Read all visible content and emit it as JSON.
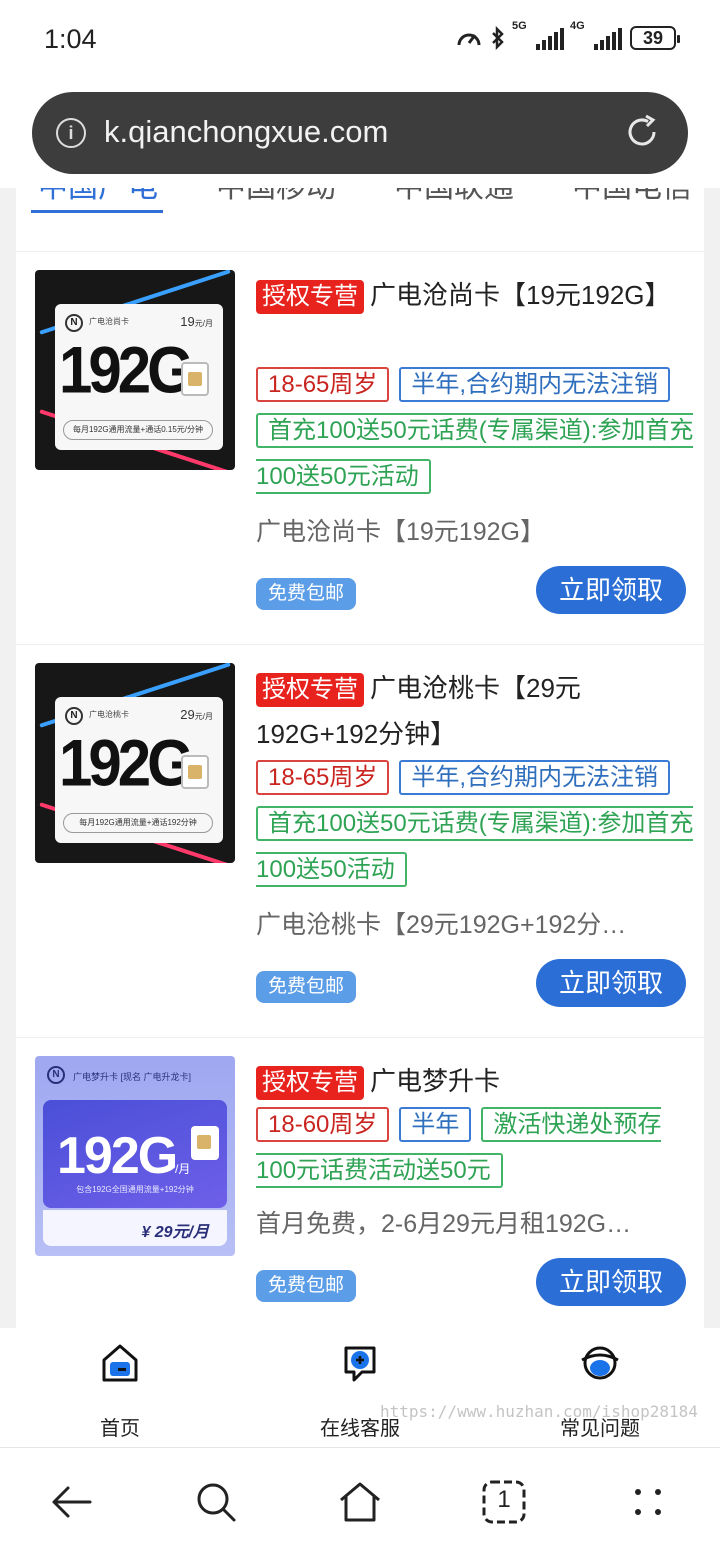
{
  "status": {
    "time": "1:04",
    "battery": "39",
    "net1": "5G",
    "net2": "4G"
  },
  "browser": {
    "url": "k.qianchongxue.com"
  },
  "tabs": [
    "中国广电",
    "中国移动",
    "中国联通",
    "中国电信"
  ],
  "products": [
    {
      "badge": "授权专营",
      "title": "广电沧尚卡【19元192G】",
      "tags": [
        {
          "text": "18-65周岁",
          "color": "red"
        },
        {
          "text": "半年,合约期内无法注销",
          "color": "blue"
        },
        {
          "text": "首充100送50元话费(专属渠道):参加首充100送50元活动",
          "color": "green"
        }
      ],
      "desc": "广电沧尚卡【19元192G】",
      "shipping": "免费包邮",
      "cta": "立即领取",
      "art": {
        "big": "192G",
        "price": "19",
        "unit": "元/月",
        "brand": "广电沧尚卡",
        "note": "每月192G通用流量+通话0.15元/分钟"
      }
    },
    {
      "badge": "授权专营",
      "title": "广电沧桃卡【29元192G+192分钟】",
      "tags": [
        {
          "text": "18-65周岁",
          "color": "red"
        },
        {
          "text": "半年,合约期内无法注销",
          "color": "blue"
        },
        {
          "text": "首充100送50元话费(专属渠道):参加首充100送50活动",
          "color": "green"
        }
      ],
      "desc": "广电沧桃卡【29元192G+192分…",
      "shipping": "免费包邮",
      "cta": "立即领取",
      "art": {
        "big": "192G",
        "price": "29",
        "unit": "元/月",
        "brand": "广电沧桃卡",
        "note": "每月192G通用流量+通话192分钟"
      }
    },
    {
      "badge": "授权专营",
      "title": "广电梦升卡",
      "tags": [
        {
          "text": "18-60周岁",
          "color": "red"
        },
        {
          "text": "半年",
          "color": "blue"
        },
        {
          "text": "激活快递处预存100元话费活动送50元",
          "color": "green"
        }
      ],
      "desc": "首月免费，2-6月29元月租192G…",
      "shipping": "免费包邮",
      "cta": "立即领取",
      "art": {
        "head": "广电梦升卡 [现名 广电升龙卡]",
        "big": "192G",
        "unit": "/月",
        "line": "包含192G全国通用流量+192分钟",
        "price": "¥ 29元/月"
      }
    }
  ],
  "site_nav": [
    {
      "label": "首页",
      "icon": "home-icon"
    },
    {
      "label": "在线客服",
      "icon": "chat-icon"
    },
    {
      "label": "常见问题",
      "icon": "faq-icon"
    }
  ],
  "watermark": "https://www.huzhan.com/ishop28184",
  "browser_bar": {
    "tabs_count": "1"
  }
}
